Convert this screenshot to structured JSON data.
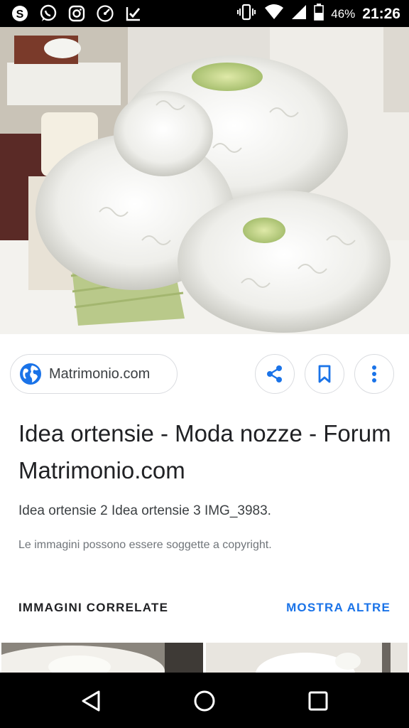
{
  "status_bar": {
    "left_icons": [
      "skype-icon",
      "whatsapp-icon",
      "instagram-icon",
      "speedometer-icon",
      "checklist-icon"
    ],
    "battery_percent": "46%",
    "time": "21:26"
  },
  "result": {
    "source_name": "Matrimonio.com",
    "title": "Idea ortensie - Moda nozze - Forum Matrimonio.com",
    "description": "Idea ortensie 2 Idea ortensie 3 IMG_3983.",
    "copyright_notice": "Le immagini possono essere soggette a copyright."
  },
  "actions": [
    "share-icon",
    "bookmark-icon",
    "more-vert-icon"
  ],
  "related": {
    "heading": "IMMAGINI CORRELATE",
    "more_label": "MOSTRA ALTRE"
  },
  "colors": {
    "accent": "#1a73e8",
    "status_bar": "#000000",
    "nav_bar": "#000000"
  }
}
